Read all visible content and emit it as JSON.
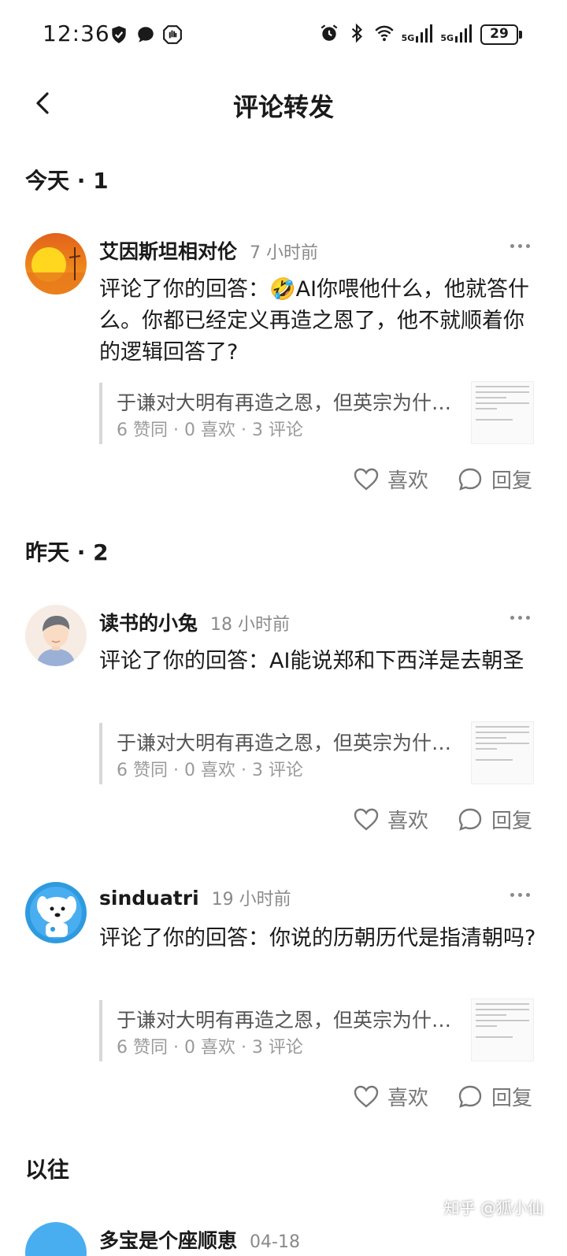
{
  "status_bar": {
    "time": "12:36",
    "battery": "29",
    "network_left": "5G",
    "network_right": "5G"
  },
  "header": {
    "title": "评论转发"
  },
  "sections": {
    "today": "今天 · 1",
    "yesterday": "昨天 · 2",
    "earlier": "以往"
  },
  "notifications": [
    {
      "username": "艾因斯坦相对伦",
      "time": "7 小时前",
      "prefix": "评论了你的回答：",
      "emoji": "🤣",
      "comment": "AI你喂他什么，他就答什么。你都已经定义再造之恩了，他不就顺着你的逻辑回答了?",
      "quote_title": "于谦对大明有再造之恩，但英宗为什么还要杀他？",
      "quote_stats": "6 赞同 · 0 喜欢 · 3 评论",
      "like_label": "喜欢",
      "reply_label": "回复"
    },
    {
      "username": "读书的小兔",
      "time": "18 小时前",
      "prefix": "评论了你的回答：",
      "comment": "AI能说郑和下西洋是去朝圣",
      "quote_title": "于谦对大明有再造之恩，但英宗为什么还要杀他？",
      "quote_stats": "6 赞同 · 0 喜欢 · 3 评论",
      "like_label": "喜欢",
      "reply_label": "回复"
    },
    {
      "username": "sinduatri",
      "time": "19 小时前",
      "prefix": "评论了你的回答：",
      "comment": "你说的历朝历代是指清朝吗?",
      "quote_title": "于谦对大明有再造之恩，但英宗为什么还要杀他？",
      "quote_stats": "6 赞同 · 0 喜欢 · 3 评论",
      "like_label": "喜欢",
      "reply_label": "回复"
    },
    {
      "username": "多宝是个座顺恵",
      "time": "04-18"
    }
  ],
  "watermark": "知乎 @狐小仙",
  "colors": {
    "text_primary": "#1a1a1a",
    "text_secondary": "#8a8a8a",
    "quote_bar": "#d8d8d8",
    "background": "#ffffff"
  }
}
